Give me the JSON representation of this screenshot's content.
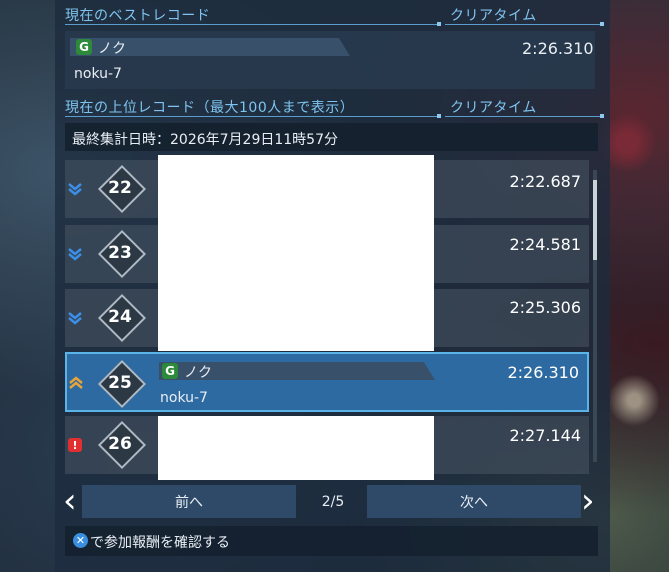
{
  "best_record": {
    "header": "現在のベストレコード",
    "time_header": "クリアタイム",
    "class_icon": "G",
    "player_name": "ノク",
    "player_id": "noku-7",
    "time": "2:26.310"
  },
  "ranking": {
    "header": "現在の上位レコード（最大100人まで表示）",
    "time_header": "クリアタイム",
    "last_updated": "最終集計日時：2026年7月29日11時57分",
    "rows": [
      {
        "rank": "22",
        "trend": "down",
        "time": "2:22.687"
      },
      {
        "rank": "23",
        "trend": "down",
        "time": "2:24.581"
      },
      {
        "rank": "24",
        "trend": "down",
        "time": "2:25.306"
      },
      {
        "rank": "25",
        "trend": "up",
        "time": "2:26.310",
        "class_icon": "G",
        "player_name": "ノク",
        "player_id": "noku-7"
      },
      {
        "rank": "26",
        "trend": "new",
        "time": "2:27.144"
      }
    ]
  },
  "pagination": {
    "prev_label": "前へ",
    "next_label": "次へ",
    "page": "2/5"
  },
  "footer": {
    "button_glyph": "✕",
    "text": "で参加報酬を確認する"
  },
  "colors": {
    "accent": "#7fc4f0",
    "selected_row": "#2e6aa2",
    "trend_down": "#3b8fe8",
    "trend_up": "#e8a43a",
    "trend_new": "#e03030",
    "class_icon": "#2c8a3a"
  }
}
